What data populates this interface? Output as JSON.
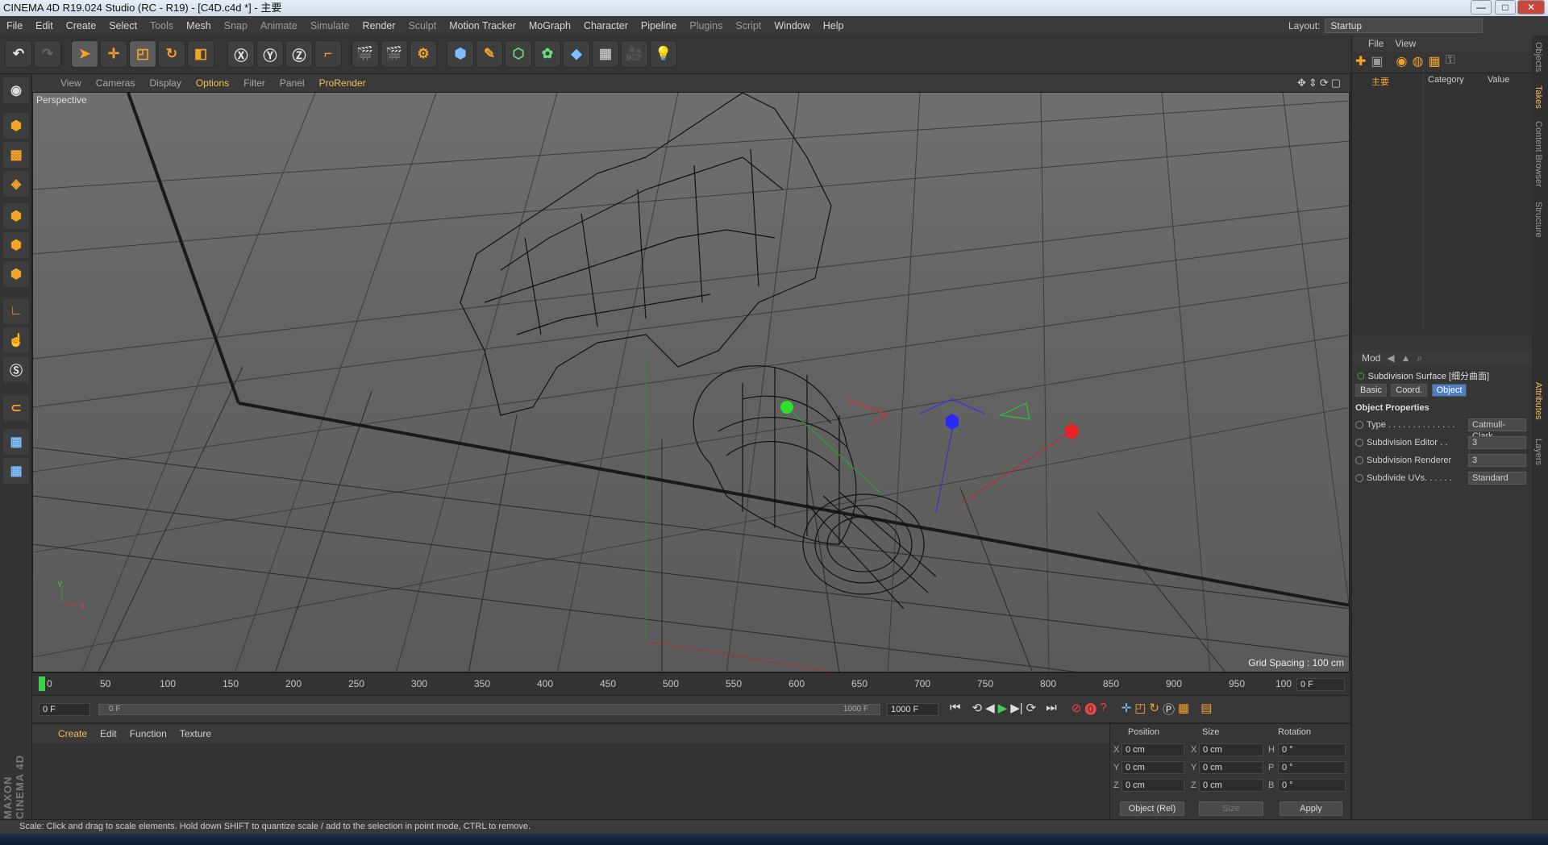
{
  "window": {
    "title": "CINEMA 4D R19.024 Studio (RC - R19) - [C4D.c4d *] - 主要",
    "min": "—",
    "max": "□",
    "close": "✕"
  },
  "menu": [
    "File",
    "Edit",
    "Create",
    "Select",
    "Tools",
    "Mesh",
    "Snap",
    "Animate",
    "Simulate",
    "Render",
    "Sculpt",
    "Motion Tracker",
    "MoGraph",
    "Character",
    "Pipeline",
    "Plugins",
    "Script",
    "Window",
    "Help"
  ],
  "layout": {
    "label": "Layout:",
    "value": "Startup"
  },
  "viewport": {
    "menu": [
      "View",
      "Cameras",
      "Display",
      "Options",
      "Filter",
      "Panel",
      "ProRender"
    ],
    "camera": "Perspective",
    "grid_spacing": "Grid Spacing : 100 cm",
    "axis_y": "Y",
    "axis_x": "X"
  },
  "timeline": {
    "ticks": [
      "0",
      "50",
      "100",
      "150",
      "200",
      "250",
      "300",
      "350",
      "400",
      "450",
      "500",
      "550",
      "600",
      "650",
      "700",
      "750",
      "800",
      "850",
      "900",
      "950",
      "100"
    ],
    "current": "0 F"
  },
  "anim": {
    "start": "0 F",
    "range_start": "0 F",
    "range_end": "1000 F",
    "end": "1000 F"
  },
  "material": {
    "menu": [
      "Create",
      "Edit",
      "Function",
      "Texture"
    ]
  },
  "coords": {
    "headers": {
      "position": "Position",
      "size": "Size",
      "rotation": "Rotation"
    },
    "axes": [
      "X",
      "Y",
      "Z"
    ],
    "rot_axes": [
      "H",
      "P",
      "B"
    ],
    "pos": [
      "0 cm",
      "0 cm",
      "0 cm"
    ],
    "size": [
      "0 cm",
      "0 cm",
      "0 cm"
    ],
    "rot": [
      "0 °",
      "0 °",
      "0 °"
    ],
    "mode": "Object (Rel)",
    "size_mode": "Size",
    "apply": "Apply"
  },
  "objects": {
    "menu": [
      "File",
      "View"
    ],
    "item": "主要",
    "col_category": "Category",
    "col_value": "Value"
  },
  "attributes": {
    "mode": "Mod",
    "object": "Subdivision Surface [细分曲面]",
    "tabs": [
      "Basic",
      "Coord.",
      "Object"
    ],
    "section": "Object Properties",
    "props": [
      {
        "label": "Type . . . . . . . . . . . . . .",
        "value": "Catmull-Clark"
      },
      {
        "label": "Subdivision Editor . .",
        "value": "3"
      },
      {
        "label": "Subdivision Renderer",
        "value": "3"
      },
      {
        "label": "Subdivide UVs. . . . . .",
        "value": "Standard"
      }
    ]
  },
  "side_tabs": [
    "Objects",
    "Takes",
    "Content Browser",
    "Structure",
    "Attributes",
    "Layers"
  ],
  "status": "Scale: Click and drag to scale elements. Hold down SHIFT to quantize scale / add to the selection in point mode, CTRL to remove.",
  "brand": "MAXON CINEMA 4D"
}
